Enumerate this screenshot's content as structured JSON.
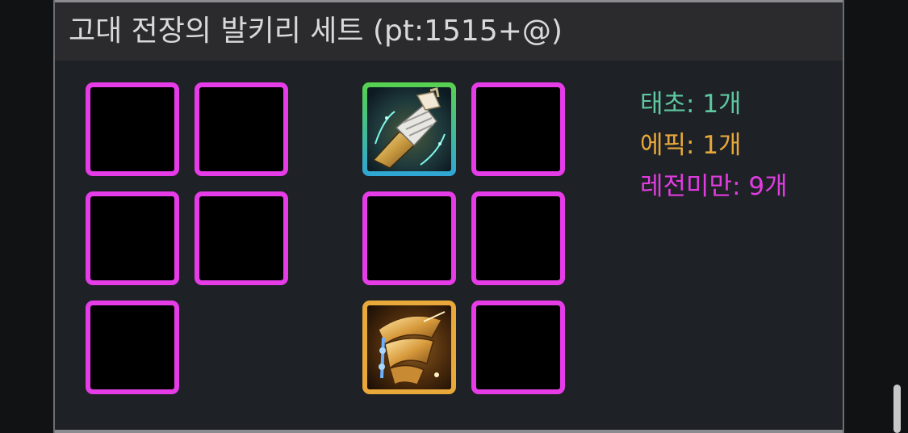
{
  "title": "고대 전장의 발키리 세트 (pt:1515+@)",
  "stats": [
    {
      "label": "태초: 1개",
      "color": "#5ec9a0"
    },
    {
      "label": "에픽: 1개",
      "color": "#e8a83a"
    },
    {
      "label": "레전미만: 9개",
      "color": "#e03ce0"
    }
  ],
  "slots_left": [
    {
      "grade": "legend-under"
    },
    {
      "grade": "legend-under"
    },
    {
      "grade": "legend-under"
    },
    {
      "grade": "legend-under"
    },
    {
      "grade": "legend-under"
    }
  ],
  "slots_right": [
    {
      "grade": "taecho",
      "icon": "gauntlet-icon"
    },
    {
      "grade": "legend-under"
    },
    {
      "grade": "legend-under"
    },
    {
      "grade": "legend-under"
    },
    {
      "grade": "epic",
      "icon": "shoulder-armor-icon"
    },
    {
      "grade": "legend-under"
    }
  ],
  "colors": {
    "legend_under_border": "#e53ce8",
    "epic_border": "#e8a83a",
    "taecho_border_top": "#58d24e",
    "taecho_border_bottom": "#2fa6d6"
  }
}
